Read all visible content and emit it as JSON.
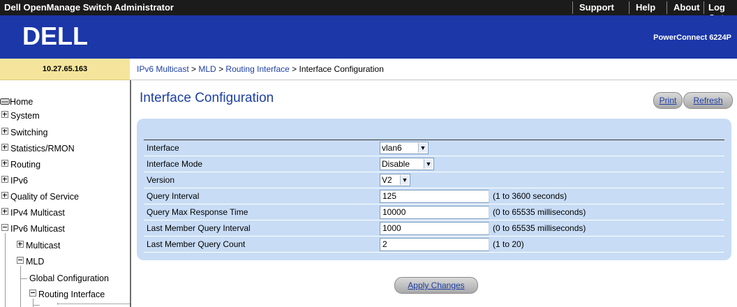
{
  "topbar": {
    "app_title": "Dell OpenManage Switch Administrator",
    "links": [
      "Support",
      "Help",
      "About",
      "Log Out"
    ]
  },
  "banner": {
    "logo_text": "DELL",
    "product": "PowerConnect 6224P"
  },
  "ip": "10.27.65.163",
  "breadcrumb": {
    "links": [
      "IPv6 Multicast",
      "MLD",
      "Routing Interface"
    ],
    "separator": " > ",
    "current": "Interface Configuration"
  },
  "sidebar": {
    "items": [
      {
        "label": "Home",
        "icon": "drive-icon"
      },
      {
        "label": "System"
      },
      {
        "label": "Switching"
      },
      {
        "label": "Statistics/RMON"
      },
      {
        "label": "Routing"
      },
      {
        "label": "IPv6"
      },
      {
        "label": "Quality of Service"
      },
      {
        "label": "IPv4 Multicast"
      },
      {
        "label": "IPv6 Multicast"
      },
      {
        "label": "Multicast"
      },
      {
        "label": "MLD"
      },
      {
        "label": "Global Configuration"
      },
      {
        "label": "Routing Interface"
      }
    ]
  },
  "main": {
    "title": "Interface Configuration",
    "print_label": "Print",
    "refresh_label": "Refresh",
    "apply_label": "Apply Changes"
  },
  "form": {
    "rows": [
      {
        "label": "Interface",
        "value": "vlan6",
        "type": "select",
        "range": ""
      },
      {
        "label": "Interface Mode",
        "value": "Disable",
        "type": "select",
        "range": ""
      },
      {
        "label": "Version",
        "value": "V2",
        "type": "select",
        "range": ""
      },
      {
        "label": "Query Interval",
        "value": "125",
        "type": "text",
        "range": "(1 to 3600 seconds)"
      },
      {
        "label": "Query Max Response Time",
        "value": "10000",
        "type": "text",
        "range": "(0 to 65535 milliseconds)"
      },
      {
        "label": "Last Member Query Interval",
        "value": "1000",
        "type": "text",
        "range": "(0 to 65535 milliseconds)"
      },
      {
        "label": "Last Member Query Count",
        "value": "2",
        "type": "text",
        "range": "(1 to 20)"
      }
    ]
  },
  "colors": {
    "banner": "#1b37a8",
    "ip_cell": "#f5e59c",
    "panel": "#c8dcf5",
    "link": "#1d3fa5"
  }
}
